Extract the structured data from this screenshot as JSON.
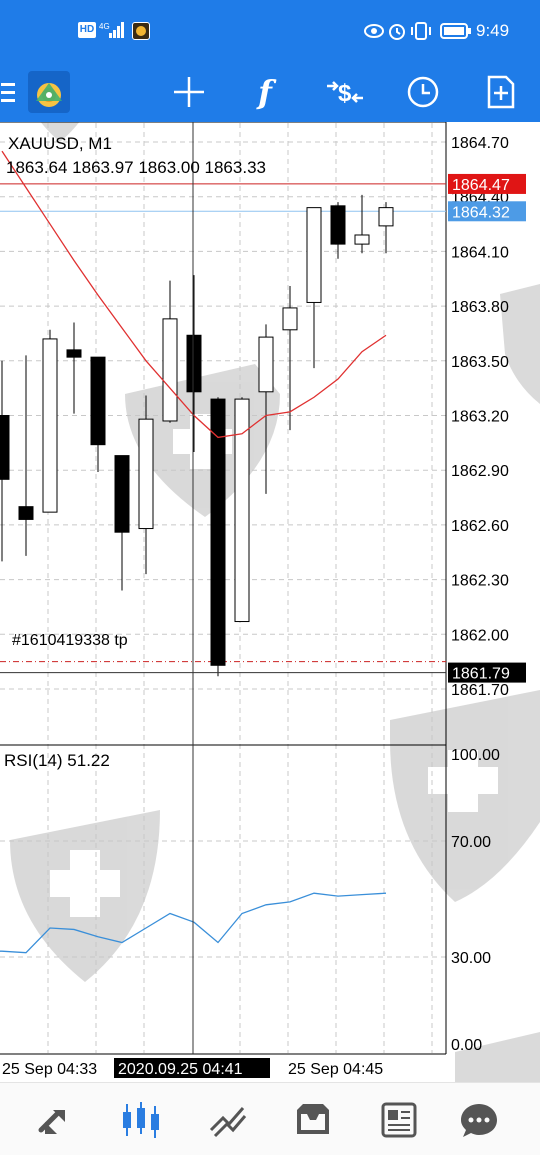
{
  "status_bar": {
    "time": "9:49",
    "network_badge_hd": "HD",
    "network_badge_4g": "4G",
    "icons": [
      "hd-icon",
      "signal-icon",
      "app-notification-icon",
      "eye-icon",
      "alarm-icon",
      "vibrate-icon",
      "battery-icon"
    ]
  },
  "toolbar": {
    "icons": [
      "menu-icon",
      "app-logo-icon",
      "crosshair-icon",
      "function-icon",
      "trade-icon",
      "clock-icon",
      "new-order-icon"
    ],
    "function_glyph": "f",
    "trade_glyph": "$"
  },
  "chart": {
    "symbol_line": "XAUUSD, M1",
    "ohlc_line": "1863.64 1863.97 1863.00 1863.33",
    "order_label": "#1610419338 tp",
    "rsi_label": "RSI(14) 51.22",
    "price_labels": [
      "1864.70",
      "1864.40",
      "1864.10",
      "1863.80",
      "1863.50",
      "1863.20",
      "1862.90",
      "1862.60",
      "1862.30",
      "1862.00",
      "1861.70"
    ],
    "ask_tag": "1864.47",
    "bid_tag": "1864.32",
    "cursor_tag": "1861.79",
    "rsi_levels": [
      "100.00",
      "70.00",
      "30.00",
      "0.00"
    ],
    "time_labels": [
      "25 Sep 04:33",
      "25 Sep 04:45"
    ],
    "time_cursor_tag": "2020.09.25 04:41",
    "colors": {
      "ask_line": "#cc2222",
      "ask_tag": "#e01515",
      "bid_line": "#8fc3f0",
      "bid_tag": "#4d9be6",
      "ma_line": "#e03131",
      "rsi_line": "#3a8fd9",
      "tp_line": "#cc2222",
      "cursor_tag": "#000000"
    }
  },
  "chart_data": {
    "type": "candlestick",
    "symbol": "XAUUSD",
    "timeframe": "M1",
    "price_ylim": [
      1861.7,
      1864.7
    ],
    "candles": [
      {
        "open": 1863.2,
        "high": 1863.5,
        "low": 1862.4,
        "close": 1862.85
      },
      {
        "open": 1862.7,
        "high": 1863.53,
        "low": 1862.43,
        "close": 1862.63
      },
      {
        "open": 1862.67,
        "high": 1863.67,
        "low": 1862.67,
        "close": 1863.62
      },
      {
        "open": 1863.56,
        "high": 1863.71,
        "low": 1863.21,
        "close": 1863.52
      },
      {
        "open": 1863.52,
        "high": 1863.52,
        "low": 1862.89,
        "close": 1863.04
      },
      {
        "open": 1862.98,
        "high": 1862.98,
        "low": 1862.24,
        "close": 1862.56
      },
      {
        "open": 1862.58,
        "high": 1863.31,
        "low": 1862.33,
        "close": 1863.18
      },
      {
        "open": 1863.17,
        "high": 1863.94,
        "low": 1863.16,
        "close": 1863.73
      },
      {
        "open": 1863.64,
        "high": 1863.97,
        "low": 1863.0,
        "close": 1863.33
      },
      {
        "open": 1863.29,
        "high": 1863.3,
        "low": 1861.77,
        "close": 1861.83
      },
      {
        "open": 1862.07,
        "high": 1863.3,
        "low": 1862.07,
        "close": 1863.29
      },
      {
        "open": 1863.33,
        "high": 1863.7,
        "low": 1862.77,
        "close": 1863.63
      },
      {
        "open": 1863.67,
        "high": 1863.91,
        "low": 1863.12,
        "close": 1863.79
      },
      {
        "open": 1863.82,
        "high": 1864.34,
        "low": 1863.46,
        "close": 1864.34
      },
      {
        "open": 1864.35,
        "high": 1864.37,
        "low": 1864.06,
        "close": 1864.14
      },
      {
        "open": 1864.14,
        "high": 1864.41,
        "low": 1864.09,
        "close": 1864.19
      },
      {
        "open": 1864.24,
        "high": 1864.37,
        "low": 1864.09,
        "close": 1864.34
      }
    ],
    "candle_x_index": [
      0,
      1,
      2,
      3,
      4,
      5,
      6,
      7,
      8,
      9,
      10,
      11,
      12,
      13,
      14,
      15,
      16
    ],
    "moving_average": [
      1864.65,
      1864.45,
      1864.25,
      1864.05,
      1863.86,
      1863.68,
      1863.5,
      1863.35,
      1863.2,
      1863.08,
      1863.1,
      1863.2,
      1863.22,
      1863.3,
      1863.4,
      1863.55,
      1863.64
    ],
    "ask_price": 1864.47,
    "bid_price": 1864.32,
    "take_profit": 1861.85,
    "cursor_price": 1861.79,
    "rsi": {
      "period": 14,
      "current": 51.22,
      "ylim": [
        0,
        100
      ],
      "levels": [
        70,
        30
      ],
      "values": [
        32,
        31.5,
        40,
        39.5,
        37,
        35,
        40,
        45,
        42,
        35,
        45,
        48,
        49,
        52,
        51,
        51.5,
        52
      ]
    }
  },
  "bottom_nav": {
    "items": [
      "quotes-icon",
      "chart-icon",
      "trade-icon",
      "history-icon",
      "news-icon",
      "messages-icon"
    ]
  }
}
